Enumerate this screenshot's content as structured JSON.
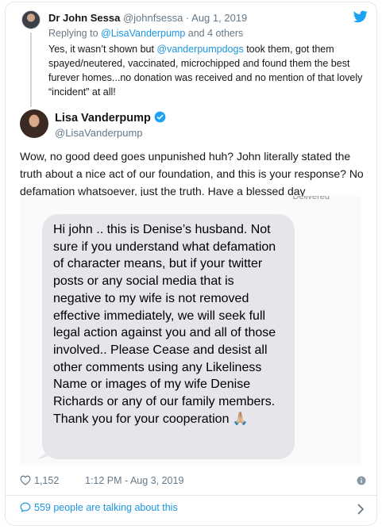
{
  "reply": {
    "name": "Dr John Sessa",
    "handle": "@johnfsessa",
    "date": "· Aug 1, 2019",
    "replying_prefix": "Replying to ",
    "replying_user": "@LisaVanderpump",
    "replying_suffix": " and 4 others",
    "text_before": "Yes, it wasn’t shown but ",
    "text_mention": "@vanderpumpdogs",
    "text_after": " took them, got them spayed/neutered, vaccinated, microchipped and found them the best furever homes...no donation was received and no mention of that lovely “incident” at all!"
  },
  "author": {
    "name": "Lisa Vanderpump",
    "handle": "@LisaVanderpump"
  },
  "tweet": {
    "text": "Wow, no good deed goes unpunished huh? John literally stated the truth about a nice act of our foundation, and this is your response? No defamation whatsoever, just the truth. Have a blessed day"
  },
  "media": {
    "delivered": "Delivered",
    "message": "Hi john .. this is  Denise’s husband. Not sure if you understand what defamation of character means, but if your twitter posts or any social media that is negative to my wife is not removed effective immediately, we will seek full legal action against you and all of those involved.. Please Cease and desist all other comments using any Likeliness Name or images of my wife Denise Richards or any of our family members. Thank you for your cooperation 🙏🏼"
  },
  "footer": {
    "likes": "1,152",
    "timestamp": "1:12 PM - Aug 3, 2019",
    "talking": "559 people are talking about this"
  },
  "colors": {
    "link": "#1b95e0",
    "muted": "#657786",
    "bubble": "#e5e5ea"
  },
  "icons": [
    "twitter-bird-icon",
    "verified-icon",
    "heart-icon",
    "info-icon",
    "speech-bubble-icon",
    "chevron-right-icon"
  ]
}
